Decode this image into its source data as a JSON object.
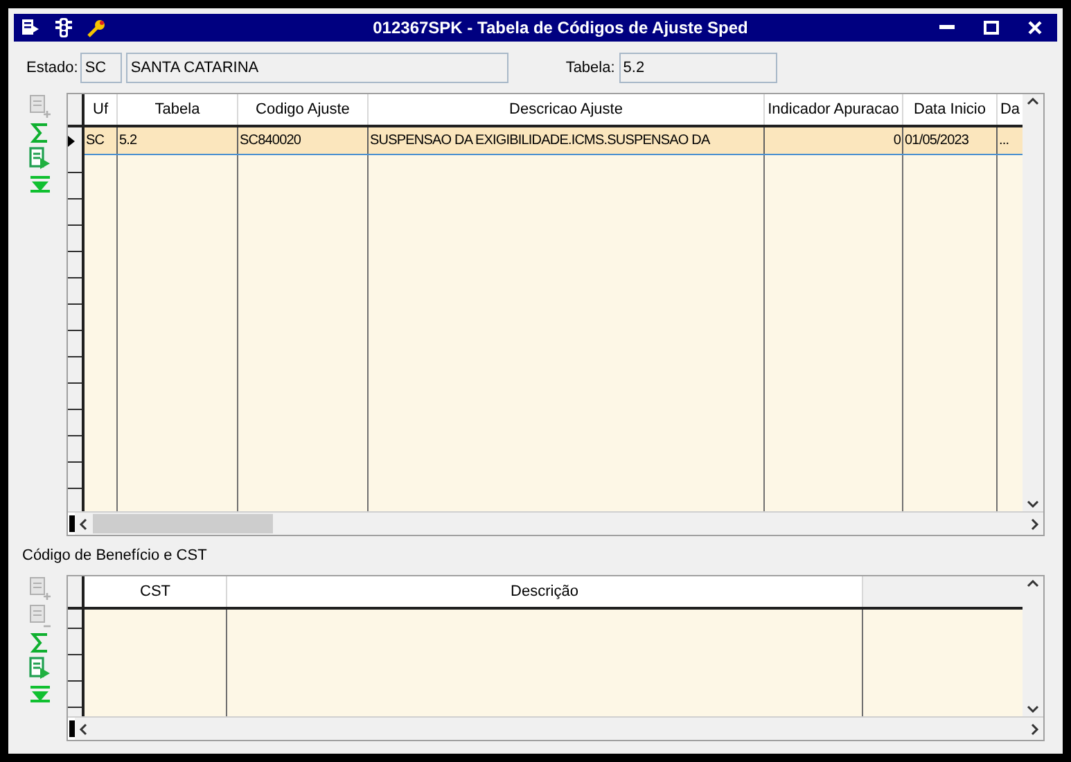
{
  "window": {
    "title": "012367SPK - Tabela de Códigos de Ajuste Sped"
  },
  "filters": {
    "estado_label": "Estado:",
    "estado_code": "SC",
    "estado_name": "SANTA CATARINA",
    "tabela_label": "Tabela:",
    "tabela_value": "5.2"
  },
  "grid": {
    "columns": [
      "Uf",
      "Tabela",
      "Codigo Ajuste",
      "Descricao Ajuste",
      "Indicador Apuracao",
      "Data Inicio",
      "Da"
    ],
    "rows": [
      {
        "selected": true,
        "cells": [
          "SC",
          "5.2",
          "SC840020",
          "SUSPENSAO DA EXIGIBILIDADE.ICMS.SUSPENSAO DA",
          "0",
          "01/05/2023",
          "..."
        ]
      }
    ]
  },
  "section_title": "Código de Benefício e CST",
  "detail_grid": {
    "columns": [
      "CST",
      "Descrição"
    ]
  }
}
